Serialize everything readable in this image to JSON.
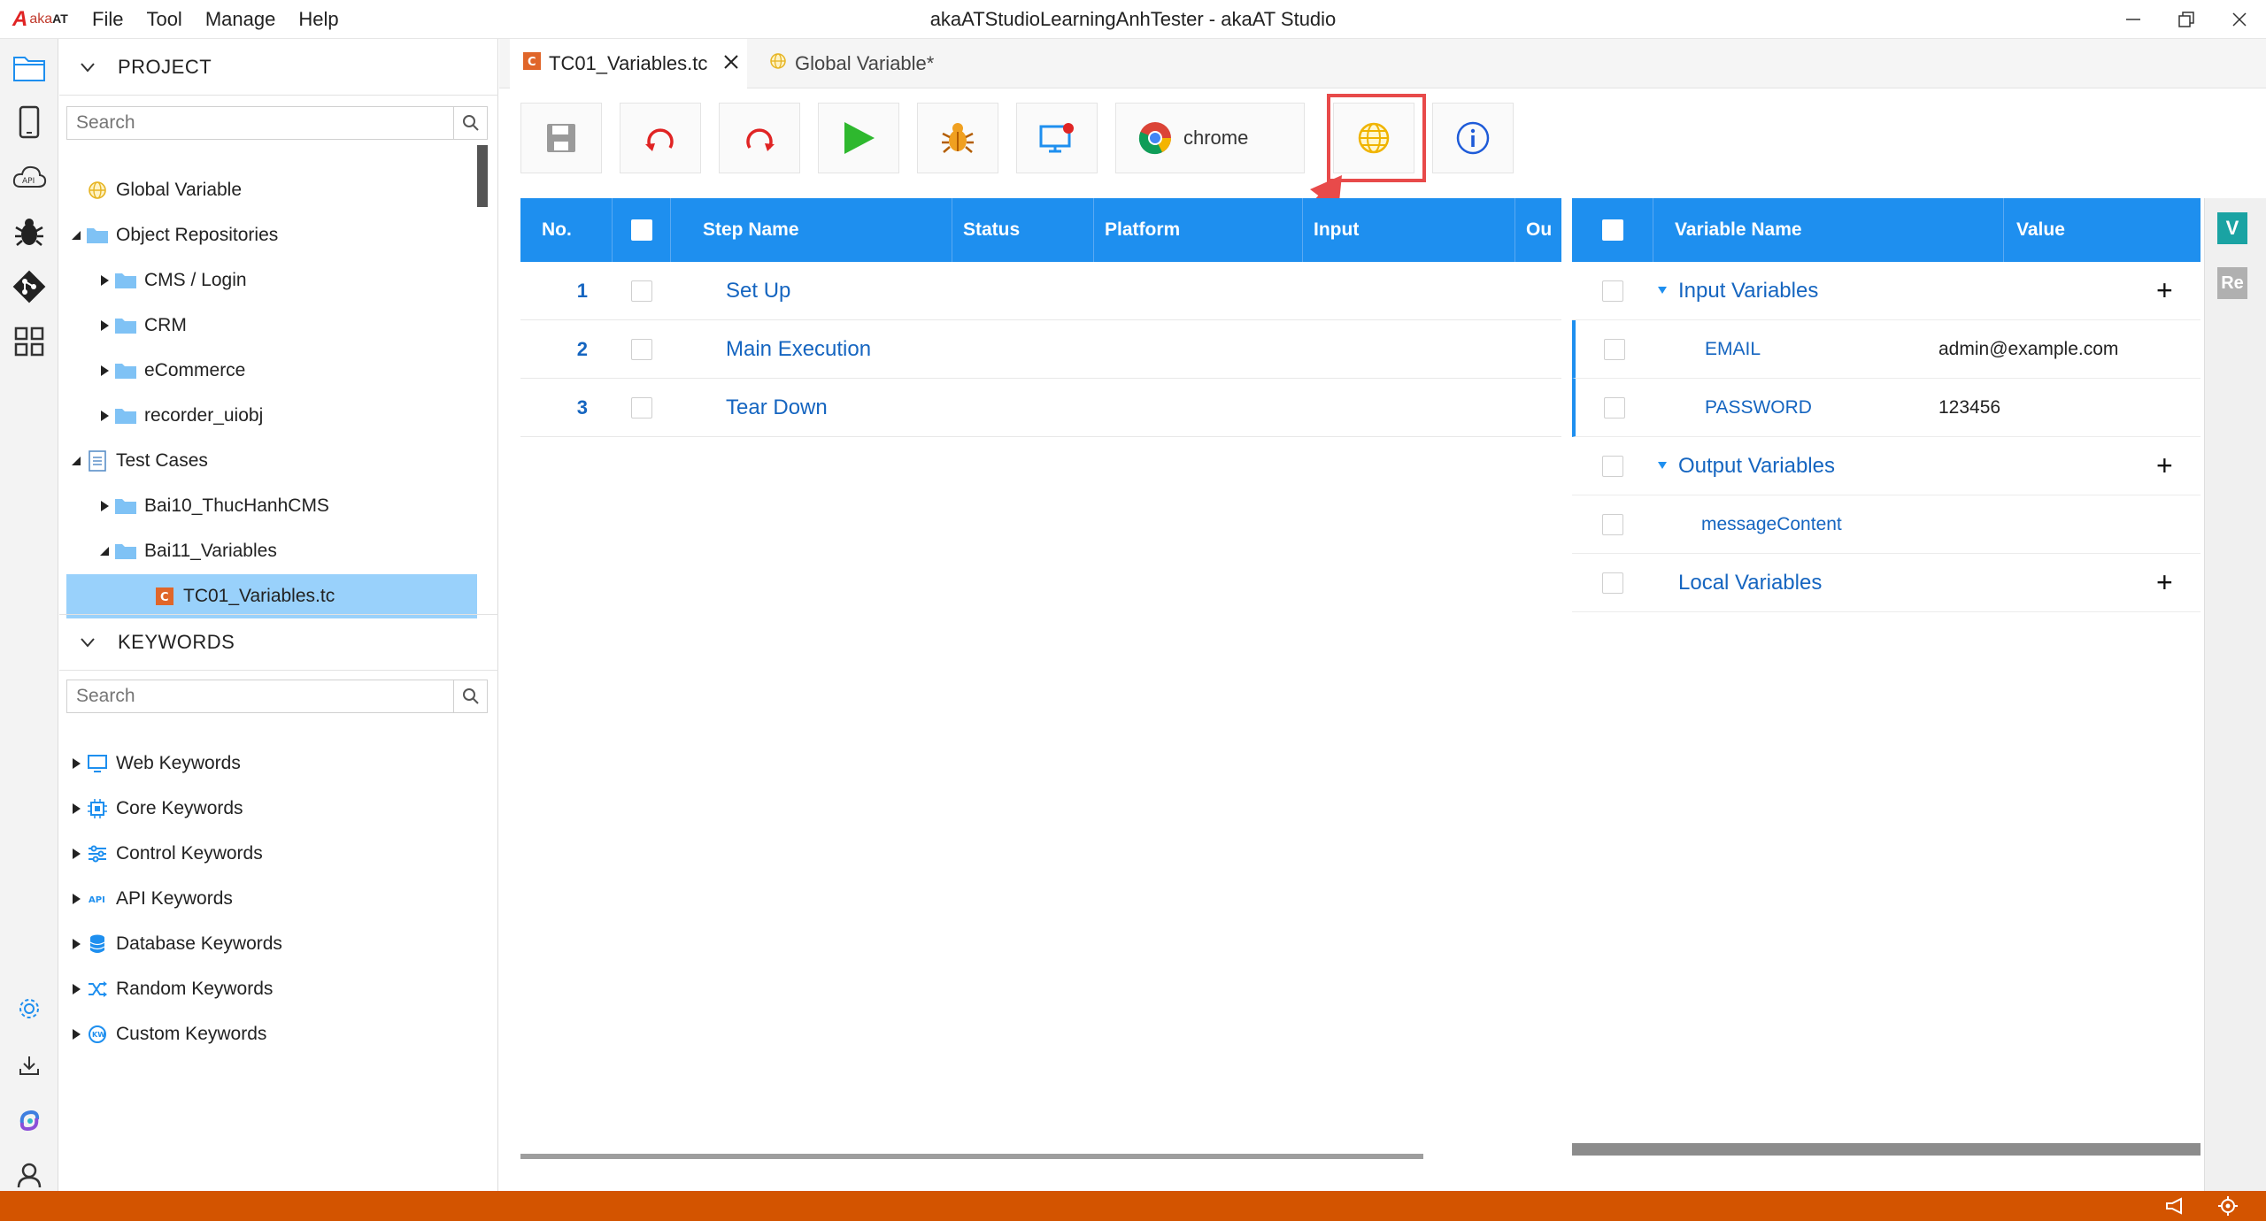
{
  "app": {
    "logo_mark": "A",
    "logo_text": "aka",
    "logo_text_bold": "AT",
    "window_title": "akaATStudioLearningAnhTester - akaAT Studio",
    "menu": [
      "File",
      "Tool",
      "Manage",
      "Help"
    ]
  },
  "sidebar": {
    "project": {
      "title": "PROJECT",
      "search_placeholder": "Search",
      "items": [
        {
          "label": "Global Variable",
          "icon": "globe-icon"
        },
        {
          "label": "Object Repositories",
          "icon": "folder-icon"
        },
        {
          "label": "CMS / Login",
          "icon": "folder-icon"
        },
        {
          "label": "CRM",
          "icon": "folder-icon"
        },
        {
          "label": "eCommerce",
          "icon": "folder-icon"
        },
        {
          "label": "recorder_uiobj",
          "icon": "folder-icon"
        },
        {
          "label": "Test Cases",
          "icon": "document-icon"
        },
        {
          "label": "Bai10_ThucHanhCMS",
          "icon": "folder-icon"
        },
        {
          "label": "Bai11_Variables",
          "icon": "folder-icon"
        },
        {
          "label": "TC01_Variables.tc",
          "icon": "testcase-icon"
        }
      ]
    },
    "keywords": {
      "title": "KEYWORDS",
      "search_placeholder": "Search",
      "items": [
        {
          "label": "Web Keywords",
          "icon": "monitor-icon"
        },
        {
          "label": "Core Keywords",
          "icon": "chip-icon"
        },
        {
          "label": "Control Keywords",
          "icon": "sliders-icon"
        },
        {
          "label": "API Keywords",
          "icon": "api-icon"
        },
        {
          "label": "Database Keywords",
          "icon": "database-icon"
        },
        {
          "label": "Random Keywords",
          "icon": "shuffle-icon"
        },
        {
          "label": "Custom Keywords",
          "icon": "custom-icon"
        }
      ]
    }
  },
  "tabs": [
    {
      "label": "TC01_Variables.tc",
      "badge": "C",
      "active": true
    },
    {
      "label": "Global Variable*",
      "active": false
    }
  ],
  "toolbar": {
    "browser_label": "chrome",
    "buttons": [
      "save-icon",
      "undo-icon",
      "redo-icon",
      "play-icon",
      "debug-icon",
      "remote-icon",
      "chrome-icon",
      "globe-icon",
      "info-icon"
    ]
  },
  "steps": {
    "columns": [
      "No.",
      "Step Name",
      "Status",
      "Platform",
      "Input",
      "Ou"
    ],
    "rows": [
      {
        "no": "1",
        "name": "Set Up"
      },
      {
        "no": "2",
        "name": "Main Execution"
      },
      {
        "no": "3",
        "name": "Tear Down"
      }
    ]
  },
  "variables": {
    "columns": [
      "Variable Name",
      "Value"
    ],
    "groups": {
      "input": {
        "label": "Input Variables",
        "add": "+"
      },
      "output": {
        "label": "Output Variables",
        "add": "+"
      },
      "local": {
        "label": "Local Variables",
        "add": "+"
      }
    },
    "input_vars": [
      {
        "name": "EMAIL",
        "value": "admin@example.com"
      },
      {
        "name": "PASSWORD",
        "value": "123456"
      }
    ],
    "output_vars": [
      {
        "name": "messageContent",
        "value": ""
      }
    ]
  },
  "rail": {
    "v_label": "V",
    "re_label": "Re"
  },
  "colors": {
    "accent": "#1e8fef",
    "status_bar": "#d35400",
    "selected": "#99d1fb",
    "highlight": "#e84a4a",
    "link": "#1565c0"
  }
}
